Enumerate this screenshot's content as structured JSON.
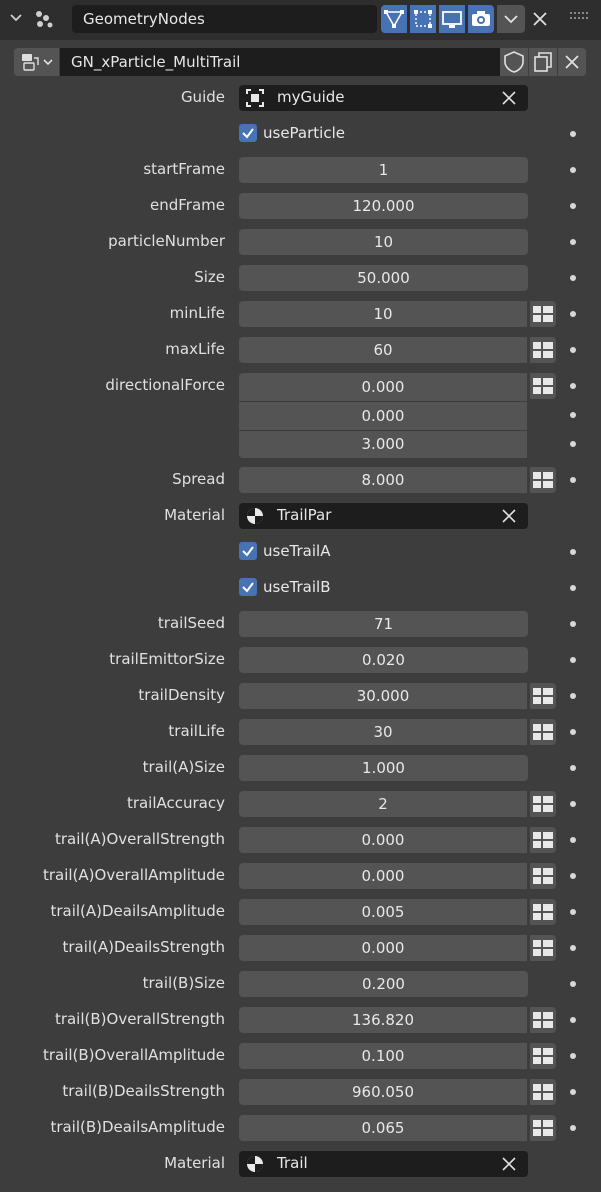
{
  "header": {
    "modifier_name": "GeometryNodes",
    "toggles": [
      "edit-mode-icon",
      "on-cage-icon",
      "viewport-icon",
      "render-icon"
    ]
  },
  "node_group": {
    "name": "GN_xParticle_MultiTrail"
  },
  "guide": {
    "label": "Guide",
    "value": "myGuide"
  },
  "use_particle": {
    "label": "useParticle",
    "checked": true
  },
  "rows_a": [
    {
      "label": "startFrame",
      "value": "1",
      "attr": false
    },
    {
      "label": "endFrame",
      "value": "120.000",
      "attr": false
    },
    {
      "label": "particleNumber",
      "value": "10",
      "attr": false
    },
    {
      "label": "Size",
      "value": "50.000",
      "attr": false
    },
    {
      "label": "minLife",
      "value": "10",
      "attr": true
    },
    {
      "label": "maxLife",
      "value": "60",
      "attr": true
    }
  ],
  "directional_force": {
    "label": "directionalForce",
    "values": [
      "0.000",
      "0.000",
      "3.000"
    ]
  },
  "spread": {
    "label": "Spread",
    "value": "8.000"
  },
  "material1": {
    "label": "Material",
    "value": "TrailPar"
  },
  "use_trail_a": {
    "label": "useTrailA",
    "checked": true
  },
  "use_trail_b": {
    "label": "useTrailB",
    "checked": true
  },
  "rows_b": [
    {
      "label": "trailSeed",
      "value": "71",
      "attr": false
    },
    {
      "label": "trailEmittorSize",
      "value": "0.020",
      "attr": false
    },
    {
      "label": "trailDensity",
      "value": "30.000",
      "attr": true
    },
    {
      "label": "trailLife",
      "value": "30",
      "attr": true
    },
    {
      "label": "trail(A)Size",
      "value": "1.000",
      "attr": false
    },
    {
      "label": "trailAccuracy",
      "value": "2",
      "attr": true
    },
    {
      "label": "trail(A)OverallStrength",
      "value": "0.000",
      "attr": true
    },
    {
      "label": "trail(A)OverallAmplitude",
      "value": "0.000",
      "attr": true
    },
    {
      "label": "trail(A)DeailsAmplitude",
      "value": "0.005",
      "attr": true
    },
    {
      "label": "trail(A)DeailsStrength",
      "value": "0.000",
      "attr": true
    },
    {
      "label": "trail(B)Size",
      "value": "0.200",
      "attr": false
    },
    {
      "label": "trail(B)OverallStrength",
      "value": "136.820",
      "attr": true
    },
    {
      "label": "trail(B)OverallAmplitude",
      "value": "0.100",
      "attr": true
    },
    {
      "label": "trail(B)DeailsStrength",
      "value": "960.050",
      "attr": true
    },
    {
      "label": "trail(B)DeailsAmplitude",
      "value": "0.065",
      "attr": true
    }
  ],
  "material2": {
    "label": "Material",
    "value": "Trail"
  },
  "colors": {
    "panel": "#3d3d3d",
    "field": "#545454",
    "dark_field": "#1d1d1d",
    "accent": "#4772b3"
  }
}
